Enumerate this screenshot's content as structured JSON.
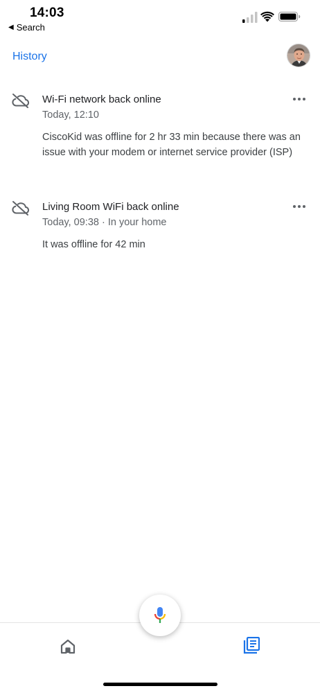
{
  "status_bar": {
    "time": "14:03",
    "back_label": "Search",
    "back_arrow": "◀",
    "signal_icon": "cellular-signal-icon",
    "wifi_icon": "wifi-icon",
    "battery_icon": "battery-icon"
  },
  "header": {
    "title": "History",
    "avatar_icon": "user-avatar"
  },
  "feed": {
    "items": [
      {
        "icon": "cloud-off-icon",
        "title": "Wi-Fi network back online",
        "meta": "Today, 12:10",
        "body": "CiscoKid was offline for 2 hr 33 min because there was an issue with your modem or internet service provider (ISP)"
      },
      {
        "icon": "cloud-off-icon",
        "title": "Living Room WiFi back online",
        "meta": "Today, 09:38 · In your home",
        "body": "It was offline for 42 min"
      }
    ]
  },
  "bottom_nav": {
    "home_icon": "home-icon",
    "feed_icon": "feed-icon",
    "mic_icon": "microphone-icon"
  },
  "colors": {
    "accent": "#1a73e8",
    "text_primary": "#202124",
    "text_secondary": "#5f6368",
    "mic_blue": "#4285f4",
    "mic_red": "#ea4335",
    "mic_yellow": "#fbbc04",
    "mic_green": "#34a853"
  }
}
